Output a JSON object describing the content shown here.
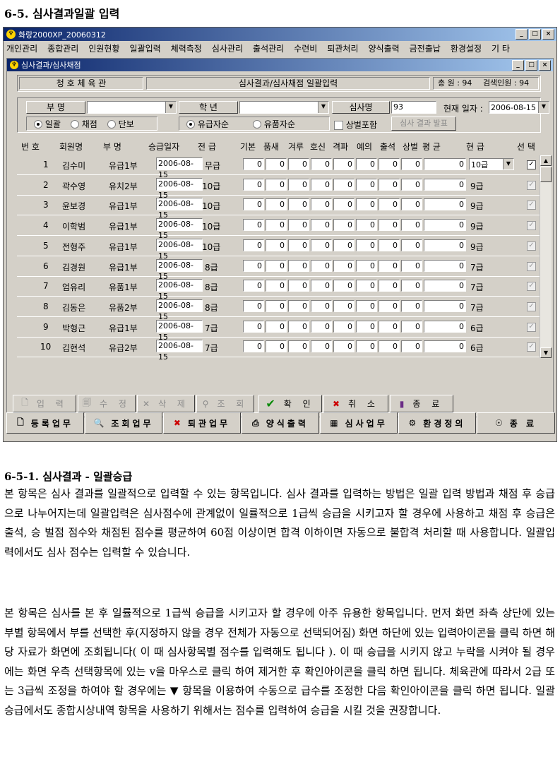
{
  "doc": {
    "heading": "6-5. 심사결과일괄 입력",
    "subheading": "6-5-1. 심사결과 - 일괄승급",
    "para1": "본 항목은 심사 결과를 일괄적으로 입력할 수 있는 항목입니다. 심사 결과를 입력하는 방법은 일괄 입력 방법과 채점 후 승급으로 나누어지는데 일괄입력은 심사점수에 관계없이 일률적으로 1급씩 승급을 시키고자 할 경우에 사용하고 채점 후 승급은 출석, 승 벌점 점수와 채점된 점수를 평균하여 60점 이상이면 합격 이하이면 자동으로 불합격 처리할 때 사용합니다. 일괄입력에서도 심사 점수는 입력할 수 있습니다.",
    "para2": "본 항목은 심사를 본 후 일률적으로 1급씩 승급을 시키고자 할 경우에 아주 유용한 항목입니다. 먼저 화면 좌측 상단에 있는 부별 항목에서 부를 선택한 후(지정하지 않을 경우 전체가 자동으로 선택되어짐) 화면 하단에 있는 입력아이콘을 클릭 하면 해당 자료가 화면에 조회됩니다( 이 때 심사항목별 점수를 입력해도 됩니다 ). 이 때 승급을 시키지 않고 누락을 시켜야 될 경우에는 화면 우측 선택항목에 있는 v을 마우스로 클릭 하여 제거한 후 확인아이콘을 클릭 하면 됩니다. 체육관에 따라서 2급 또는 3급씩 조정을 하여야 할 경우에는 ▼ 항목을 이용하여 수동으로 급수를 조정한 다음 확인아이콘을 클릭 하면 됩니다. 일괄승급에서도 종합시상내역 항목을 사용하기 위해서는 점수를 입력하여 승급을 시킬 것을 권장합니다."
  },
  "app": {
    "title": "화랑2000XP_20060312",
    "menu": [
      "개인관리",
      "종합관리",
      "인원현황",
      "일괄입력",
      "체력측정",
      "심사관리",
      "출석관리",
      "수련비",
      "퇴관처리",
      "양식출력",
      "금전출납",
      "환경설정",
      "기 타"
    ],
    "child_title": "심사결과/심사채점",
    "gym": "청 호 체 육 관",
    "screen_name": "심사결과/심사채점 일괄입력",
    "total": "총 원 : 94",
    "searched": "검색인원 : 94",
    "filters": {
      "dept_label": "부 명",
      "grade_label": "학 년",
      "examiner_label": "심사명",
      "examiner_value": "93",
      "date_label": "현재 일자 :",
      "date_value": "2006-08-15",
      "mode_options": [
        "일괄",
        "채점",
        "단보"
      ],
      "promo_options": [
        "유급자순",
        "유품자순"
      ],
      "merit_label": "상벌포함",
      "announce_button": "심사 결과 발표"
    },
    "columns": [
      "번 호",
      "회원명",
      "부 명",
      "승급일자",
      "전 급",
      "기본",
      "품새",
      "겨루",
      "호신",
      "격파",
      "예의",
      "출석",
      "상벌",
      "평 균",
      "현 급",
      "선 택"
    ],
    "rows": [
      {
        "no": "1",
        "name": "김수미",
        "dept": "유급1부",
        "date": "2006-08-15",
        "prev": "무급",
        "scores": [
          "0",
          "0",
          "0",
          "0",
          "0",
          "0",
          "0",
          "0"
        ],
        "avg": "0",
        "cur": "10급",
        "selected": true
      },
      {
        "no": "2",
        "name": "곽수영",
        "dept": "유치2부",
        "date": "2006-08-15",
        "prev": "10급",
        "scores": [
          "0",
          "0",
          "0",
          "0",
          "0",
          "0",
          "0",
          "0"
        ],
        "avg": "0",
        "cur": "9급",
        "selected": true
      },
      {
        "no": "3",
        "name": "윤보경",
        "dept": "유급1부",
        "date": "2006-08-15",
        "prev": "10급",
        "scores": [
          "0",
          "0",
          "0",
          "0",
          "0",
          "0",
          "0",
          "0"
        ],
        "avg": "0",
        "cur": "9급",
        "selected": true
      },
      {
        "no": "4",
        "name": "이학범",
        "dept": "유급1부",
        "date": "2006-08-15",
        "prev": "10급",
        "scores": [
          "0",
          "0",
          "0",
          "0",
          "0",
          "0",
          "0",
          "0"
        ],
        "avg": "0",
        "cur": "9급",
        "selected": true
      },
      {
        "no": "5",
        "name": "전형주",
        "dept": "유급1부",
        "date": "2006-08-15",
        "prev": "10급",
        "scores": [
          "0",
          "0",
          "0",
          "0",
          "0",
          "0",
          "0",
          "0"
        ],
        "avg": "0",
        "cur": "9급",
        "selected": true
      },
      {
        "no": "6",
        "name": "김경원",
        "dept": "유급1부",
        "date": "2006-08-15",
        "prev": "8급",
        "scores": [
          "0",
          "0",
          "0",
          "0",
          "0",
          "0",
          "0",
          "0"
        ],
        "avg": "0",
        "cur": "7급",
        "selected": true
      },
      {
        "no": "7",
        "name": "엄유리",
        "dept": "유품1부",
        "date": "2006-08-15",
        "prev": "8급",
        "scores": [
          "0",
          "0",
          "0",
          "0",
          "0",
          "0",
          "0",
          "0"
        ],
        "avg": "0",
        "cur": "7급",
        "selected": true
      },
      {
        "no": "8",
        "name": "김동은",
        "dept": "유품2부",
        "date": "2006-08-15",
        "prev": "8급",
        "scores": [
          "0",
          "0",
          "0",
          "0",
          "0",
          "0",
          "0",
          "0"
        ],
        "avg": "0",
        "cur": "7급",
        "selected": true
      },
      {
        "no": "9",
        "name": "박형근",
        "dept": "유급1부",
        "date": "2006-08-15",
        "prev": "7급",
        "scores": [
          "0",
          "0",
          "0",
          "0",
          "0",
          "0",
          "0",
          "0"
        ],
        "avg": "0",
        "cur": "6급",
        "selected": true
      },
      {
        "no": "10",
        "name": "김현석",
        "dept": "유급2부",
        "date": "2006-08-15",
        "prev": "7급",
        "scores": [
          "0",
          "0",
          "0",
          "0",
          "0",
          "0",
          "0",
          "0"
        ],
        "avg": "0",
        "cur": "6급",
        "selected": true
      }
    ],
    "actions": {
      "input": "입 력",
      "edit": "수 정",
      "delete": "삭 제",
      "query": "조 회",
      "confirm": "확 인",
      "cancel": "취 소",
      "close": "종 료"
    },
    "bottom": [
      "등록업무",
      "조회업무",
      "퇴관업무",
      "양식출력",
      "심사업무",
      "환경정의",
      "종 료"
    ]
  }
}
